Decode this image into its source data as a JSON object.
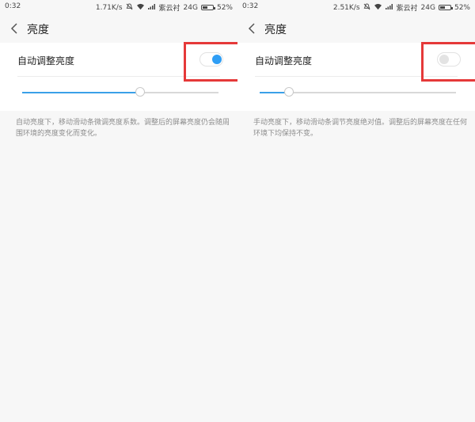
{
  "colors": {
    "accent": "#2f9ef5",
    "highlight": "#e53939",
    "background": "#f7f7f7",
    "card": "#ffffff",
    "description_text": "#8d8d8d"
  },
  "panels": [
    {
      "status": {
        "time": "0:32",
        "speed": "1.71K/s",
        "carrier": "紫云衬",
        "network": "24G",
        "battery": "52%"
      },
      "header": {
        "title": "亮度",
        "back_icon": "chevron-left-icon"
      },
      "auto_brightness": {
        "label": "自动调整亮度",
        "enabled": true,
        "highlighted": true
      },
      "brightness_slider": {
        "level": 0.6
      },
      "description": "自动亮度下，移动滑动条微调亮度系数。调整后的屏幕亮度仍会随周围环境的亮度变化而变化。"
    },
    {
      "status": {
        "time": "0:32",
        "speed": "2.51K/s",
        "carrier": "紫云衬",
        "network": "24G",
        "battery": "52%"
      },
      "header": {
        "title": "亮度",
        "back_icon": "chevron-left-icon"
      },
      "auto_brightness": {
        "label": "自动调整亮度",
        "enabled": false,
        "highlighted": true
      },
      "brightness_slider": {
        "level": 0.15
      },
      "description": "手动亮度下，移动滑动条调节亮度绝对值。调整后的屏幕亮度在任何环境下均保持不变。"
    }
  ]
}
